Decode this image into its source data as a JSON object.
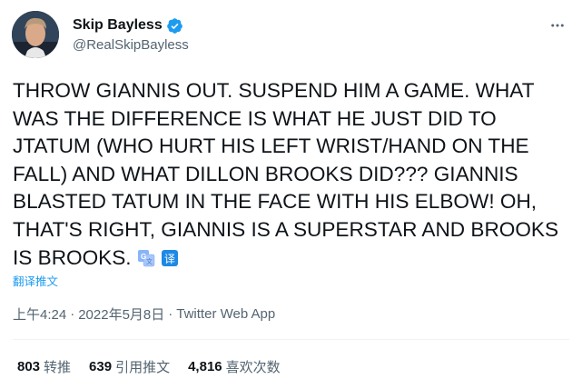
{
  "user": {
    "display_name": "Skip Bayless",
    "handle": "@RealSkipBayless",
    "verified": true
  },
  "tweet": {
    "text": "THROW GIANNIS OUT. SUSPEND HIM A GAME. WHAT WAS THE DIFFERENCE IS WHAT HE JUST DID TO JTATUM (WHO HURT HIS LEFT WRIST/HAND ON THE FALL) AND WHAT DILLON BROOKS DID??? GIANNIS BLASTED TATUM IN THE FACE WITH HIS ELBOW! OH, THAT'S RIGHT, GIANNIS IS A SUPERSTAR AND BROOKS IS BROOKS.",
    "emojis": [
      "translate-google-icon",
      "translate-yi-icon"
    ],
    "translate_label": "翻译推文"
  },
  "meta": {
    "time": "上午4:24",
    "separator": "·",
    "date": "2022年5月8日",
    "source": "Twitter Web App"
  },
  "stats": [
    {
      "count": "803",
      "label": "转推"
    },
    {
      "count": "639",
      "label": "引用推文"
    },
    {
      "count": "4,816",
      "label": "喜欢次数"
    }
  ],
  "colors": {
    "link": "#1d9bf0",
    "muted": "#536471",
    "text": "#0f1419",
    "divider": "#eff3f4"
  }
}
